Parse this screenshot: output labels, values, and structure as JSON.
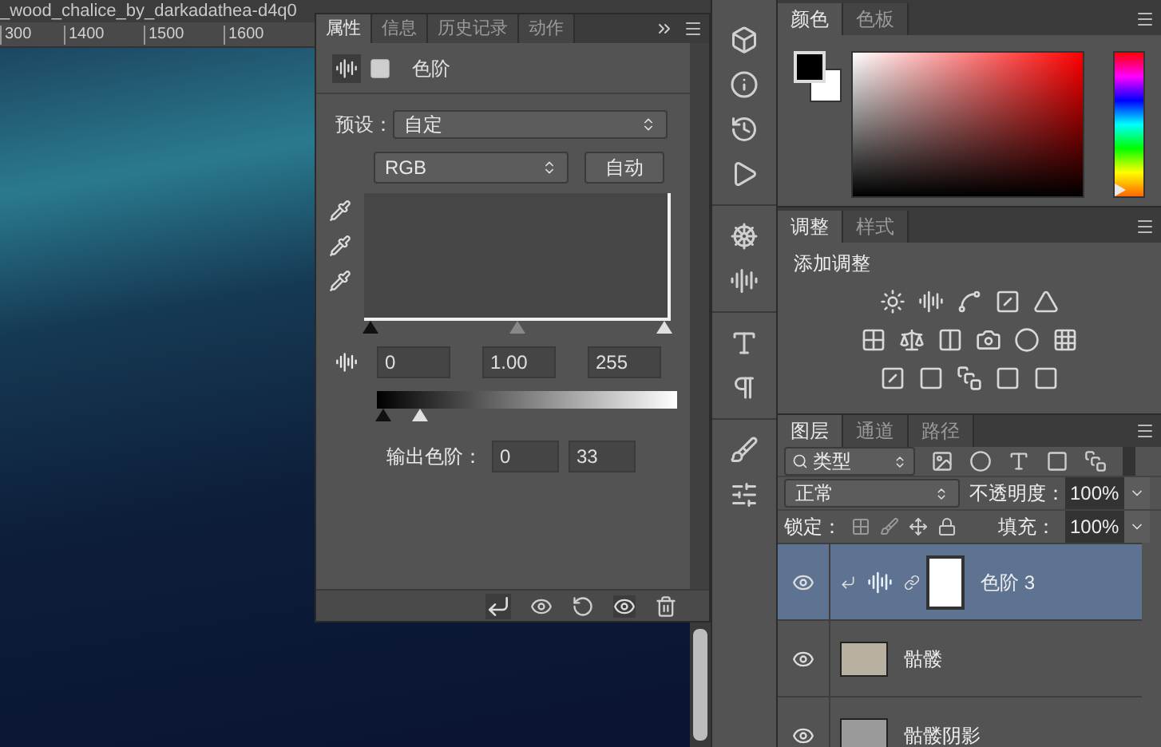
{
  "document": {
    "title": "_wood_chalice_by_darkadathea-d4q0",
    "ruler_marks": [
      "300",
      "1400",
      "1500",
      "1600"
    ]
  },
  "properties_panel": {
    "tabs": [
      {
        "label": "属性",
        "selected": true
      },
      {
        "label": "信息",
        "selected": false
      },
      {
        "label": "历史记录",
        "selected": false
      },
      {
        "label": "动作",
        "selected": false
      }
    ],
    "adjustment_title": "色阶",
    "preset_label": "预设：",
    "preset_value": "自定",
    "channel": "RGB",
    "auto_button": "自动",
    "input_sliders": [
      {
        "level": 0
      },
      {
        "level": 0.5
      },
      {
        "level": 1
      }
    ],
    "input_levels": [
      "0",
      "1.00",
      "255"
    ],
    "output_sliders": [
      {
        "level": 0
      },
      {
        "level": 0.13
      }
    ],
    "output_label": "输出色阶：",
    "output_levels": [
      "0",
      "33"
    ]
  },
  "color_panel": {
    "tabs": [
      {
        "label": "颜色",
        "selected": true
      },
      {
        "label": "色板",
        "selected": false
      }
    ],
    "hue_slider": {
      "level": 0
    }
  },
  "adjustments_panel": {
    "tabs": [
      {
        "label": "调整",
        "selected": true
      },
      {
        "label": "样式",
        "selected": false
      }
    ],
    "heading": "添加调整"
  },
  "layers_panel": {
    "tabs": [
      {
        "label": "图层",
        "selected": true
      },
      {
        "label": "通道",
        "selected": false
      },
      {
        "label": "路径",
        "selected": false
      }
    ],
    "filter": "类型",
    "blend_mode": "正常",
    "opacity_label": "不透明度：",
    "opacity": "100%",
    "lock_label": "锁定：",
    "fill_label": "填充：",
    "fill": "100%",
    "layers": [
      {
        "name": "色阶 3",
        "kind": "adjustment",
        "selected": true,
        "visible": true
      },
      {
        "name": "骷髅",
        "kind": "smart",
        "selected": false,
        "visible": true
      },
      {
        "name": "骷髅阴影",
        "kind": "pixel",
        "selected": false,
        "visible": true
      }
    ]
  }
}
